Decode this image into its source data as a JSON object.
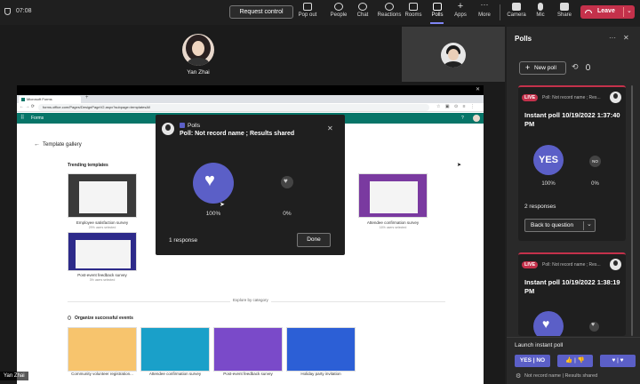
{
  "topbar": {
    "time": "07:08",
    "request_control": "Request control",
    "items": [
      {
        "label": "Pop out",
        "icon": "pop-out-icon"
      },
      {
        "label": "People",
        "icon": "people-icon"
      },
      {
        "label": "Chat",
        "icon": "chat-icon"
      },
      {
        "label": "Reactions",
        "icon": "reactions-icon"
      },
      {
        "label": "Rooms",
        "icon": "rooms-icon"
      },
      {
        "label": "Polls",
        "icon": "polls-icon"
      },
      {
        "label": "Apps",
        "icon": "apps-icon"
      },
      {
        "label": "More",
        "icon": "more-icon"
      },
      {
        "label": "Camera",
        "icon": "camera-icon"
      },
      {
        "label": "Mic",
        "icon": "mic-icon"
      },
      {
        "label": "Share",
        "icon": "share-icon"
      }
    ],
    "leave": "Leave",
    "leave_color": "#c4314b"
  },
  "participants": {
    "main_name": "Yan Zhai",
    "self_label": "Yan Zhai"
  },
  "browser": {
    "tab_title": "Microsoft Forms",
    "url": "forms.office.com/Pages/DesignPageV2.aspx?subpage=templatesAll",
    "app_name": "Forms",
    "back_label": "Template gallery",
    "trending_label": "Trending templates",
    "trending": [
      {
        "name": "Employee satisfaction survey",
        "sub": "29% users selected"
      },
      {
        "name": "Attendee confirmation survey",
        "sub": "16% users selected"
      },
      {
        "name": "Post-event feedback survey",
        "sub": "3% users selected"
      }
    ],
    "explore": "Explore by category",
    "organize": "Organize successful events",
    "events": [
      {
        "name": "Community volunteer registration..."
      },
      {
        "name": "Attendee confirmation survey"
      },
      {
        "name": "Post-event feedback survey"
      },
      {
        "name": "Holiday party invitation"
      }
    ]
  },
  "modal": {
    "app": "Polls",
    "title": "Poll: Not record name ; Results shared",
    "option1_pct": "100%",
    "option2_pct": "0%",
    "responses": "1 response",
    "done": "Done"
  },
  "polls_panel": {
    "title": "Polls",
    "new_poll": "New poll",
    "card1": {
      "live": "LIVE",
      "header": "Poll: Not record name ; Res...",
      "title": "Instant poll 10/19/2022 1:37:40 PM",
      "opt1": "YES",
      "opt2": "NO",
      "pct1": "100%",
      "pct2": "0%",
      "responses": "2 responses",
      "back": "Back to question"
    },
    "card2": {
      "live": "LIVE",
      "header": "Poll: Not record name ; Res...",
      "title": "Instant poll 10/19/2022 1:38:19 PM"
    },
    "launch_label": "Launch instant poll",
    "launch_buttons": [
      "YES | NO",
      "👍 | 👎",
      "♥ | ♥"
    ],
    "footer": "Not record name | Results shared",
    "accent": "#5b5fc7"
  }
}
